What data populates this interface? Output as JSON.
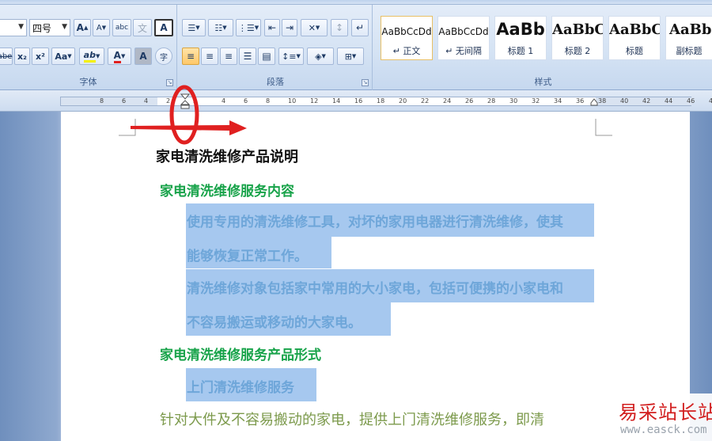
{
  "ribbon": {
    "font_group": {
      "label": "字体",
      "font_size": "四号",
      "grow_icon": "A",
      "shrink_icon": "A",
      "clear_icon": "abc",
      "phonetic_icon": "文",
      "border_icon": "A",
      "strike_label": "abe",
      "subscript_label": "x₂",
      "superscript_label": "x²",
      "case_label": "Aa",
      "highlight_label": "ab",
      "font_color_label": "A",
      "char_shading_label": "A",
      "enclose_label": "字"
    },
    "paragraph_group": {
      "label": "段落"
    },
    "styles_group": {
      "label": "样式",
      "styles": [
        {
          "sample": "AaBbCcDd",
          "name": "↵ 正文"
        },
        {
          "sample": "AaBbCcDd",
          "name": "↵ 无间隔"
        },
        {
          "sample": "AaBb",
          "name": "标题 1"
        },
        {
          "sample": "AaBbC",
          "name": "标题 2"
        },
        {
          "sample": "AaBbC",
          "name": "标题"
        },
        {
          "sample": "AaBbC",
          "name": "副标题"
        }
      ]
    }
  },
  "ruler": {
    "left_ticks": [
      "8",
      "6",
      "4",
      "2"
    ],
    "right_ticks": [
      "2",
      "4",
      "6",
      "8",
      "10",
      "12",
      "14",
      "16",
      "18",
      "20",
      "22",
      "24",
      "26",
      "28",
      "30",
      "32",
      "34",
      "36",
      "38",
      "40",
      "42",
      "44",
      "46",
      "48"
    ]
  },
  "document": {
    "title": "家电清洗维修产品说明",
    "heading_1": "家电清洗维修服务内容",
    "para_1_line_1": "使用专用的清洗维修工具，对坏的家用电器进行清洗维修，使其",
    "para_1_line_2": "能够恢复正常工作。",
    "para_2_line_1": "清洗维修对象包括家中常用的大小家电，包括可便携的小家电和",
    "para_2_line_2": "不容易搬运或移动的大家电。",
    "heading_2": "家电清洗维修服务产品形式",
    "service_line": "上门清洗维修服务",
    "last_line": "针对大件及不容易搬动的家电，提供上门清洗维修服务，即清"
  },
  "watermark": {
    "text": "易采站长站",
    "url": "www.easck.com"
  },
  "colors": {
    "selection": "#a6c8ef",
    "heading_green": "#18a34a",
    "body_blue": "#6ea6d9",
    "annotation_red": "#e02020"
  }
}
